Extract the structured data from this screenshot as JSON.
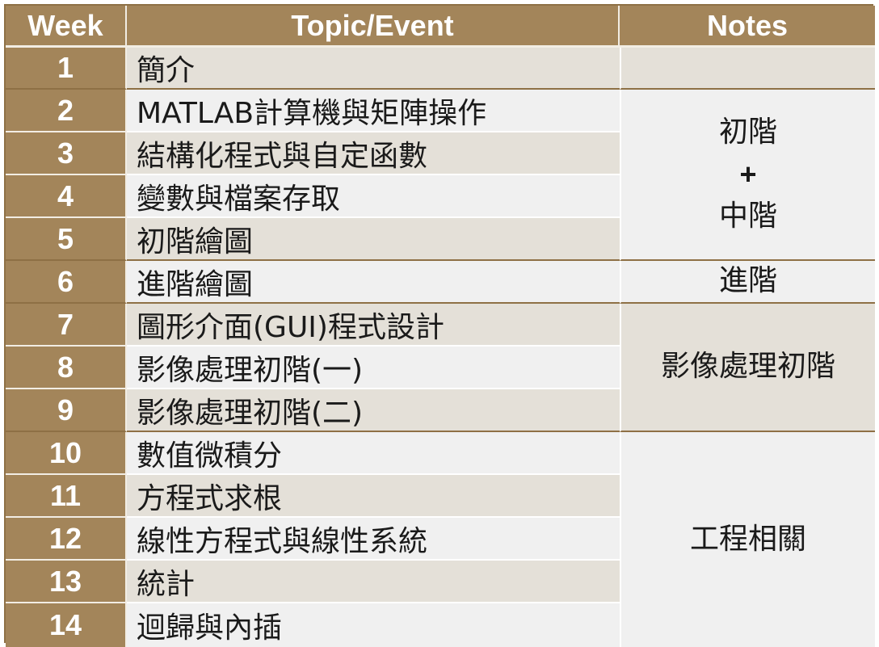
{
  "header": {
    "week": "Week",
    "topic": "Topic/Event",
    "notes": "Notes"
  },
  "rows": [
    {
      "week": "1",
      "topic": "簡介"
    },
    {
      "week": "2",
      "topic": "MATLAB計算機與矩陣操作"
    },
    {
      "week": "3",
      "topic": "結構化程式與自定函數"
    },
    {
      "week": "4",
      "topic": "變數與檔案存取"
    },
    {
      "week": "5",
      "topic": "初階繪圖"
    },
    {
      "week": "6",
      "topic": "進階繪圖"
    },
    {
      "week": "7",
      "topic": "圖形介面(GUI)程式設計"
    },
    {
      "week": "8",
      "topic": "影像處理初階(一)"
    },
    {
      "week": "9",
      "topic": "影像處理初階(二)"
    },
    {
      "week": "10",
      "topic": "數值微積分"
    },
    {
      "week": "11",
      "topic": "方程式求根"
    },
    {
      "week": "12",
      "topic": "線性方程式與線性系統"
    },
    {
      "week": "13",
      "topic": "統計"
    },
    {
      "week": "14",
      "topic": "迴歸與內插"
    }
  ],
  "notes": {
    "group1": "",
    "group2_line1": "初階",
    "group2_plus": "+",
    "group2_line2": "中階",
    "group3": "進階",
    "group4": "影像處理初階",
    "group5": "工程相關"
  },
  "colors": {
    "header_bg": "#a3855a",
    "row_light": "#f0f0f0",
    "row_dark": "#e4e0d8"
  }
}
